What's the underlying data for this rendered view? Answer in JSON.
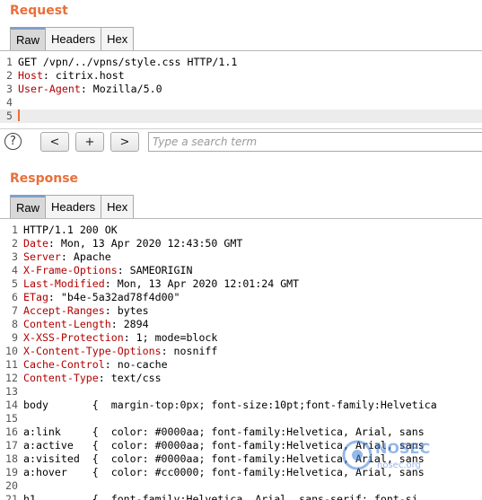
{
  "request": {
    "title": "Request",
    "tabs": [
      "Raw",
      "Headers",
      "Hex"
    ],
    "lines": [
      {
        "n": "1",
        "t": "GET /vpn/../vpns/style.css HTTP/1.1"
      },
      {
        "n": "2",
        "k": "Host",
        "v": " citrix.host"
      },
      {
        "n": "3",
        "k": "User-Agent",
        "v": " Mozilla/5.0"
      },
      {
        "n": "4",
        "t": ""
      },
      {
        "n": "5",
        "t": "",
        "cursor": true
      }
    ]
  },
  "search": {
    "help": "?",
    "prev": "<",
    "add": "+",
    "next": ">",
    "placeholder": "Type a search term"
  },
  "response": {
    "title": "Response",
    "tabs": [
      "Raw",
      "Headers",
      "Hex"
    ],
    "lines": [
      {
        "n": "1",
        "t": "HTTP/1.1 200 OK"
      },
      {
        "n": "2",
        "k": "Date",
        "v": " Mon, 13 Apr 2020 12:43:50 GMT"
      },
      {
        "n": "3",
        "k": "Server",
        "v": " Apache"
      },
      {
        "n": "4",
        "k": "X-Frame-Options",
        "v": " SAMEORIGIN"
      },
      {
        "n": "5",
        "k": "Last-Modified",
        "v": " Mon, 13 Apr 2020 12:01:24 GMT"
      },
      {
        "n": "6",
        "k": "ETag",
        "v": " \"b4e-5a32ad78f4d00\""
      },
      {
        "n": "7",
        "k": "Accept-Ranges",
        "v": " bytes"
      },
      {
        "n": "8",
        "k": "Content-Length",
        "v": " 2894"
      },
      {
        "n": "9",
        "k": "X-XSS-Protection",
        "v": " 1; mode=block"
      },
      {
        "n": "10",
        "k": "X-Content-Type-Options",
        "v": " nosniff"
      },
      {
        "n": "11",
        "k": "Cache-Control",
        "v": " no-cache"
      },
      {
        "n": "12",
        "k": "Content-Type",
        "v": " text/css"
      },
      {
        "n": "13",
        "t": ""
      },
      {
        "n": "14",
        "t": "body       {  margin-top:0px; font-size:10pt;font-family:Helvetica"
      },
      {
        "n": "15",
        "t": ""
      },
      {
        "n": "16",
        "t": "a:link     {  color: #0000aa; font-family:Helvetica, Arial, sans"
      },
      {
        "n": "17",
        "t": "a:active   {  color: #0000aa; font-family:Helvetica, Arial, sans"
      },
      {
        "n": "18",
        "t": "a:visited  {  color: #0000aa; font-family:Helvetica, Arial, sans"
      },
      {
        "n": "19",
        "t": "a:hover    {  color: #cc0000; font-family:Helvetica, Arial, sans"
      },
      {
        "n": "20",
        "t": ""
      },
      {
        "n": "21",
        "t": "h1         {  font-family:Helvetica, Arial, sans-serif; font-si"
      }
    ]
  },
  "watermark": {
    "brand": "NOSEC",
    "sub": "nosec.org"
  },
  "colors": {
    "accent": "#e8703a",
    "key": "#b30000",
    "value": "#0000aa"
  }
}
